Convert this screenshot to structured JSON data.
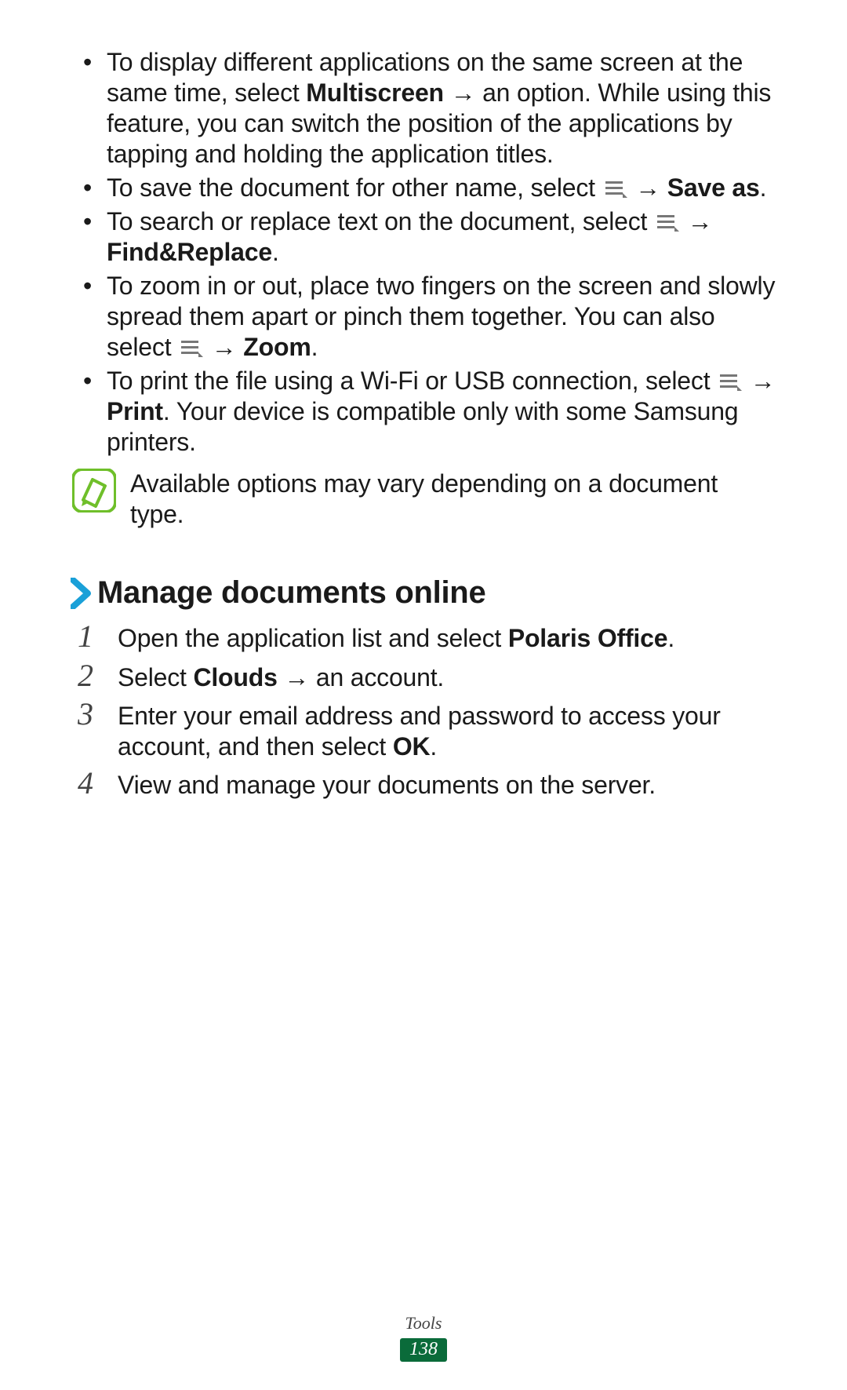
{
  "bullets": [
    {
      "pre": "To display different applications on the same screen at the same time, select ",
      "bold1": "Multiscreen",
      "mid": " → an option. While using this feature, you can switch the position of the applications by tapping and holding the application titles."
    },
    {
      "pre": "To save the document for other name, select ",
      "icon": true,
      "mid": " → ",
      "bold1": "Save as",
      "post": "."
    },
    {
      "pre": "To search or replace text on the document, select ",
      "icon": true,
      "mid": " → ",
      "bold1": "Find&Replace",
      "post": "."
    },
    {
      "pre": "To zoom in or out, place two fingers on the screen and slowly spread them apart or pinch them together. You can also select ",
      "icon": true,
      "mid": " → ",
      "bold1": "Zoom",
      "post": "."
    },
    {
      "pre": "To print the file using a Wi-Fi or USB connection, select ",
      "icon": true,
      "mid": " → ",
      "bold1": "Print",
      "post": ". Your device is compatible only with some Samsung printers."
    }
  ],
  "note": "Available options may vary depending on a document type.",
  "heading": "Manage documents online",
  "steps": [
    {
      "num": "1",
      "pre": "Open the application list and select ",
      "bold": "Polaris Office",
      "post": "."
    },
    {
      "num": "2",
      "pre": "Select ",
      "bold": "Clouds",
      "post": " → an account."
    },
    {
      "num": "3",
      "pre": "Enter your email address and password to access your account, and then select ",
      "bold": "OK",
      "post": "."
    },
    {
      "num": "4",
      "pre": "View and manage your documents on the server.",
      "bold": "",
      "post": ""
    }
  ],
  "footer": {
    "section": "Tools",
    "page": "138"
  }
}
